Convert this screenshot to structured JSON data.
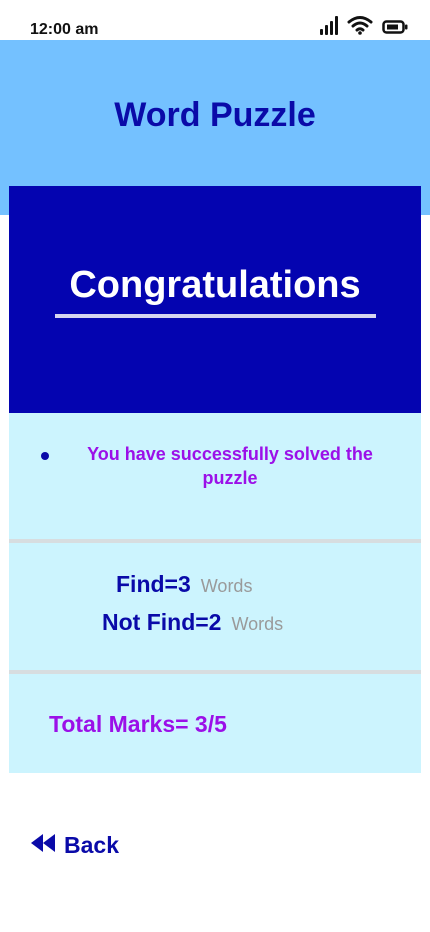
{
  "status_bar": {
    "time": "12:00 am",
    "icons": [
      "signal-icon",
      "wifi-icon",
      "battery-icon"
    ]
  },
  "header": {
    "title": "Word Puzzle"
  },
  "result": {
    "heading": "Congratulations",
    "message": "You have successfully solved the puzzle"
  },
  "stats": {
    "find_label": "Find=3",
    "find_unit": "Words",
    "not_find_label": "Not Find=2",
    "not_find_unit": "Words"
  },
  "total": {
    "label": "Total Marks= 3/5"
  },
  "back": {
    "icon": "double-arrow-left-icon",
    "label": "Back"
  },
  "colors": {
    "header_bg": "#74c1ff",
    "title": "#0a0aa8",
    "panel_bg": "#0404b0",
    "info_bg": "#ccf4fe",
    "accent_purple": "#9b10e8",
    "muted_grey": "#9a9a9a"
  }
}
